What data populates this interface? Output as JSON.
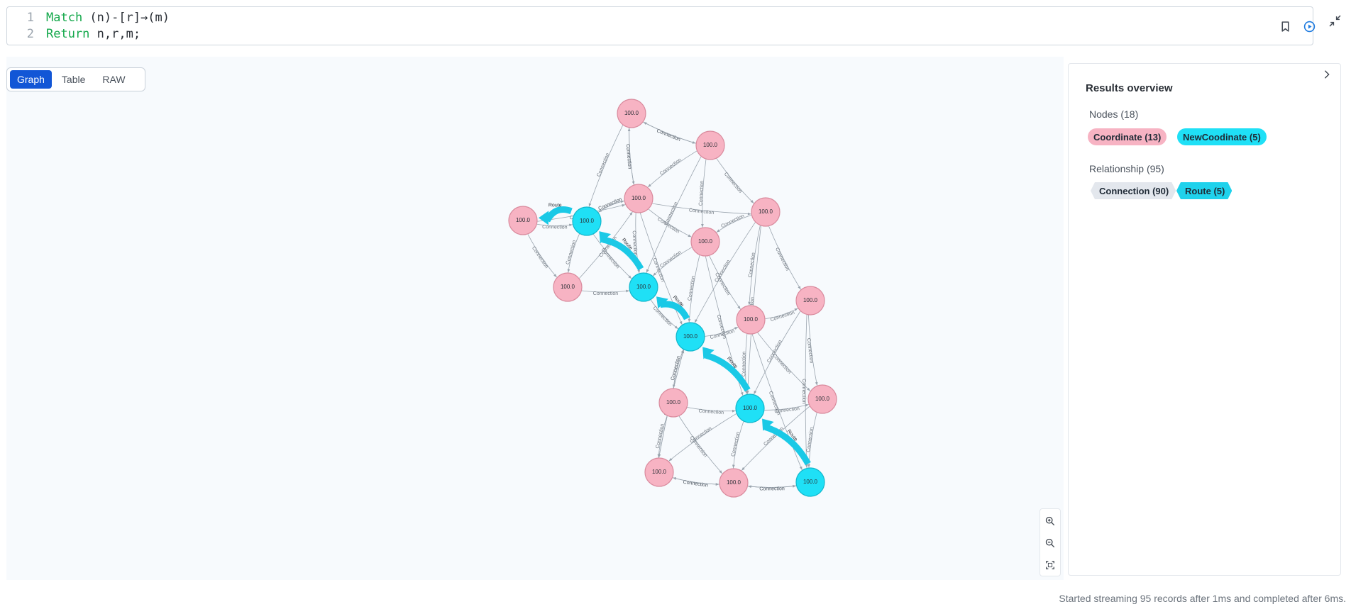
{
  "editor": {
    "lines": [
      {
        "num": "1",
        "keyword": "Match",
        "rest": " (n)-[r]→(m)"
      },
      {
        "num": "2",
        "keyword": "Return",
        "rest": " n,r,m;"
      }
    ],
    "icons": [
      "bookmark-icon",
      "run-icon",
      "collapse-icon"
    ]
  },
  "view_tabs": [
    "Graph",
    "Table",
    "RAW"
  ],
  "active_tab": "Graph",
  "graph": {
    "node_caption": "100.0",
    "edge_label_connection": "Connection",
    "edge_label_route": "Route",
    "colors": {
      "coordinate": "#f7b3c3",
      "coordinate_stroke": "#d98a9d",
      "newcoordinate": "#1fe0f6",
      "newcoordinate_stroke": "#11b7cc",
      "route": "#1ac9e6",
      "edge": "#9aa4ae"
    },
    "nodes": [
      {
        "id": "A",
        "label": "Coordinate"
      },
      {
        "id": "B",
        "label": "Coordinate"
      },
      {
        "id": "C",
        "label": "Coordinate"
      },
      {
        "id": "D",
        "label": "Coordinate"
      },
      {
        "id": "E",
        "label": "Coordinate"
      },
      {
        "id": "F",
        "label": "Coordinate"
      },
      {
        "id": "G",
        "label": "Coordinate"
      },
      {
        "id": "H",
        "label": "Coordinate"
      },
      {
        "id": "I",
        "label": "Coordinate"
      },
      {
        "id": "J",
        "label": "Coordinate"
      },
      {
        "id": "K",
        "label": "Coordinate"
      },
      {
        "id": "L",
        "label": "Coordinate"
      },
      {
        "id": "M",
        "label": "Coordinate"
      },
      {
        "id": "N1",
        "label": "NewCoodinate"
      },
      {
        "id": "N2",
        "label": "NewCoodinate"
      },
      {
        "id": "N3",
        "label": "NewCoodinate"
      },
      {
        "id": "N4",
        "label": "NewCoodinate"
      },
      {
        "id": "N5",
        "label": "NewCoodinate"
      }
    ],
    "routes": [
      [
        "N5",
        "N4"
      ],
      [
        "N4",
        "N3"
      ],
      [
        "N3",
        "N2"
      ],
      [
        "N2",
        "N1"
      ],
      [
        "N1",
        "E"
      ]
    ]
  },
  "zoom_controls": [
    "zoom-in-icon",
    "zoom-out-icon",
    "fit-icon"
  ],
  "results": {
    "title": "Results overview",
    "nodes_label": "Nodes (18)",
    "node_pills": [
      "Coordinate (13)",
      "NewCoodinate (5)"
    ],
    "relationship_label": "Relationship (95)",
    "rel_chips": [
      "Connection (90)",
      "Route (5)"
    ]
  },
  "status": "Started streaming 95 records after 1ms and completed after 6ms."
}
